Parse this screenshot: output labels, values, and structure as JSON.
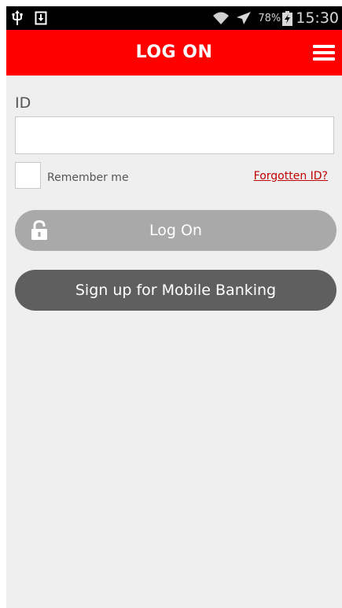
{
  "status_bar": {
    "battery_percent": "78%",
    "time": "15:30",
    "icons": [
      "usb-icon",
      "download-icon",
      "wifi-icon",
      "airplane-icon",
      "battery-charging-icon"
    ]
  },
  "header": {
    "title": "LOG ON",
    "menu_icon": "hamburger-menu-icon",
    "background": "#ff0000"
  },
  "form": {
    "id_label": "ID",
    "id_value": "",
    "remember_label": "Remember me",
    "remember_checked": false,
    "forgotten_link": "Forgotten ID?"
  },
  "buttons": {
    "logon_label": "Log On",
    "logon_icon": "lock-icon",
    "signup_label": "Sign up for Mobile Banking"
  },
  "colors": {
    "brand_red": "#ff0000",
    "link_red": "#c00000",
    "logon_disabled": "#a9a9a9",
    "signup_dark": "#5f5f5f",
    "background": "#efefef"
  }
}
